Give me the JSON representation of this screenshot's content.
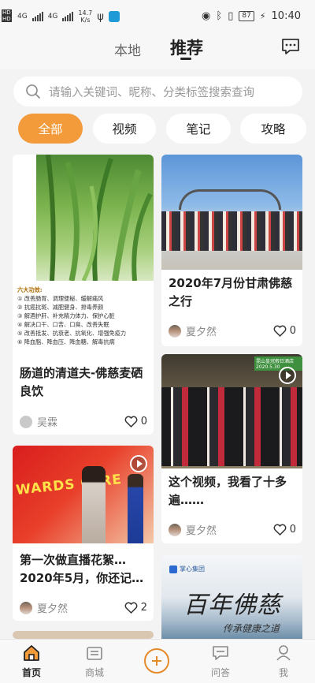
{
  "status_bar": {
    "sim1": "HD",
    "sim2": "HD",
    "network1": "4G",
    "network2": "4G",
    "speed_value": "14.7",
    "speed_unit": "K/s",
    "battery": "87",
    "time": "10:40"
  },
  "header": {
    "tab_local": "本地",
    "tab_recommend": "推荐"
  },
  "search": {
    "placeholder": "请输入关键词、昵称、分类标签搜索查询"
  },
  "categories": [
    {
      "label": "全部",
      "active": true
    },
    {
      "label": "视频",
      "active": false
    },
    {
      "label": "笔记",
      "active": false
    },
    {
      "label": "攻略",
      "active": false
    }
  ],
  "feed": {
    "left": [
      {
        "image_caption": {
          "heading": "六大功效:",
          "lines": [
            "① 改善肠胃、调理便秘、缓解痛风",
            "② 抗癌抗斑、减肥健身、排毒养颜",
            "③ 解酒护肝、补充精力体力、保护心脏",
            "④ 解决口干、口苦、口臭、改善失眠",
            "⑤ 改善抵发、抗衰老、抗氧化、增强免疫力",
            "⑥ 降血脂、降血压、降血糖、解毒抗病"
          ]
        },
        "title": "肠道的清道夫-佛慈麦硒良饮",
        "author": "吴霖",
        "likes": "0",
        "is_video": false
      },
      {
        "image_caption": {
          "banner": "WARDS CERE"
        },
        "title": "第一次做直播花絮…2020年5月，你还记…",
        "author": "夏夕然",
        "likes": "2",
        "is_video": true
      }
    ],
    "right": [
      {
        "title": "2020年7月份甘肃佛慈之行",
        "author": "夏夕然",
        "likes": "0",
        "is_video": false
      },
      {
        "image_caption": {
          "banner": "昆山皇冠假日酒店 2020.5.30"
        },
        "title": "这个视频，我看了十多遍……",
        "author": "夏夕然",
        "likes": "0",
        "is_video": true
      },
      {
        "image_caption": {
          "logo": "掌心集团",
          "calligraphy": "百年佛慈",
          "subline": "传承健康之道"
        },
        "title": "",
        "author": "",
        "likes": "",
        "is_video": false
      }
    ]
  },
  "bottom_nav": [
    {
      "label": "首页",
      "icon": "home-icon",
      "active": true
    },
    {
      "label": "商城",
      "icon": "shop-icon",
      "active": false
    },
    {
      "label": "",
      "icon": "plus-icon",
      "active": false
    },
    {
      "label": "问答",
      "icon": "qa-icon",
      "active": false
    },
    {
      "label": "我",
      "icon": "profile-icon",
      "active": false
    }
  ],
  "colors": {
    "accent": "#f39a3a",
    "background": "#f3f3f3"
  }
}
